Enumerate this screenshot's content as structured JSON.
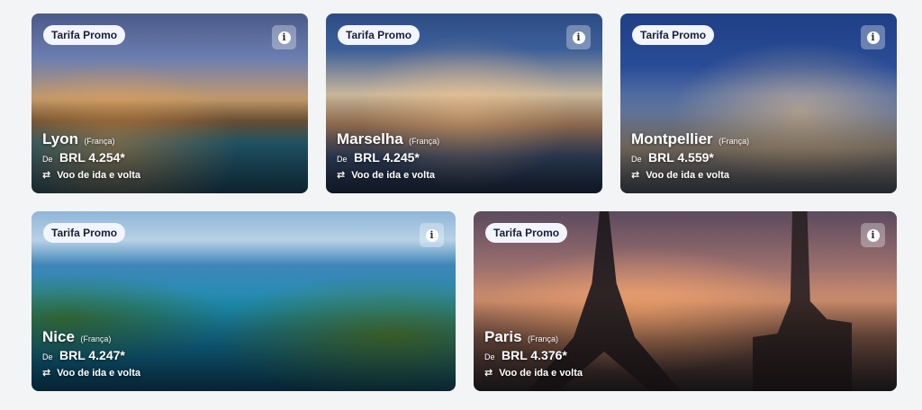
{
  "cards": [
    {
      "badge": "Tarifa Promo",
      "city": "Lyon",
      "country": "(França)",
      "from": "De",
      "price": "BRL 4.254*",
      "trip": "Voo de ida e volta"
    },
    {
      "badge": "Tarifa Promo",
      "city": "Marselha",
      "country": "(França)",
      "from": "De",
      "price": "BRL 4.245*",
      "trip": "Voo de ida e volta"
    },
    {
      "badge": "Tarifa Promo",
      "city": "Montpellier",
      "country": "(França)",
      "from": "De",
      "price": "BRL 4.559*",
      "trip": "Voo de ida e volta"
    },
    {
      "badge": "Tarifa Promo",
      "city": "Nice",
      "country": "(França)",
      "from": "De",
      "price": "BRL 4.247*",
      "trip": "Voo de ida e volta"
    },
    {
      "badge": "Tarifa Promo",
      "city": "Paris",
      "country": "(França)",
      "from": "De",
      "price": "BRL 4.376*",
      "trip": "Voo de ida e volta"
    }
  ],
  "icons": {
    "info": "info-icon",
    "round_trip": "round-trip-arrows-icon"
  },
  "colors": {
    "badge_bg": "#f2f4ff",
    "badge_text": "#1a1f36",
    "page_bg": "#f3f4f6"
  }
}
